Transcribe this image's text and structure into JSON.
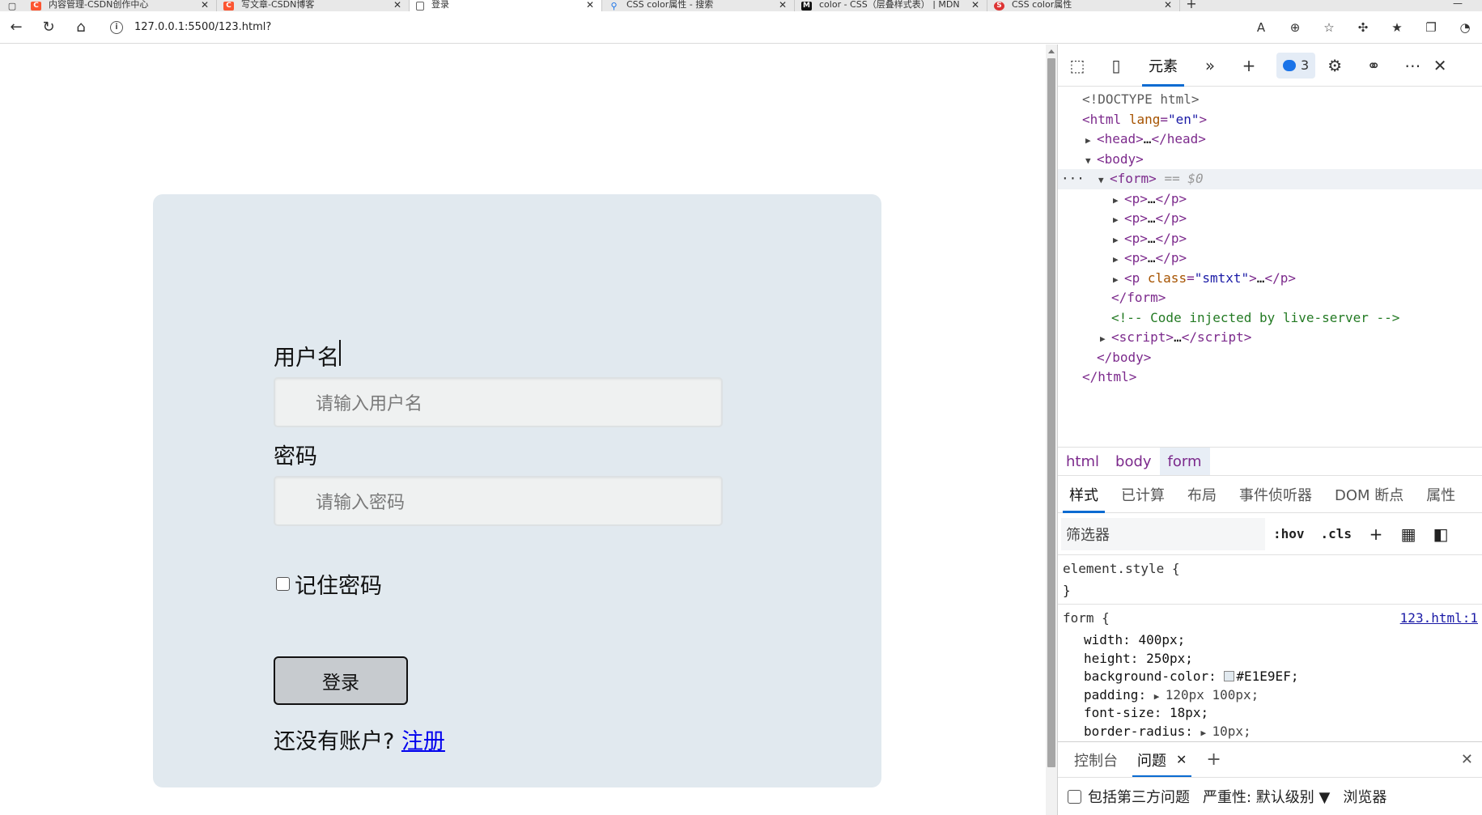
{
  "browser": {
    "tabs": [
      {
        "title": "内容管理-CSDN创作中心",
        "favicon": "C",
        "color": "#fc5531",
        "active": false
      },
      {
        "title": "写文章-CSDN博客",
        "favicon": "C",
        "color": "#fc5531",
        "active": false
      },
      {
        "title": "登录",
        "favicon": "doc",
        "color": "#ffffff",
        "active": true
      },
      {
        "title": "CSS color属性 - 搜索",
        "favicon": "search",
        "color": "#1a73e8",
        "active": false
      },
      {
        "title": "color - CSS（层叠样式表） | MDN",
        "favicon": "M",
        "color": "#111111",
        "active": false
      },
      {
        "title": "CSS color属性",
        "favicon": "S",
        "color": "#d33",
        "active": false
      }
    ],
    "url": "127.0.0.1:5500/123.html?"
  },
  "page": {
    "username_label": "用户名",
    "username_placeholder": "请输入用户名",
    "password_label": "密码",
    "password_placeholder": "请输入密码",
    "remember_label": "记住密码",
    "login_button": "登录",
    "no_account_text": "还没有账户?",
    "register_link": "注册",
    "form_bg": "#E1E9EF"
  },
  "devtools": {
    "main_tab": "元素",
    "issues_count": "3",
    "breadcrumbs": [
      "html",
      "body",
      "form"
    ],
    "sub_tabs": [
      "样式",
      "已计算",
      "布局",
      "事件侦听器",
      "DOM 断点",
      "属性"
    ],
    "filter_placeholder": "筛选器",
    "hov": ":hov",
    "cls": ".cls",
    "element_style_open": "element.style {",
    "element_style_close": "}",
    "form_rule": {
      "selector": "form {",
      "source": "123.html:1",
      "props": [
        {
          "name": "width",
          "value": "400px;"
        },
        {
          "name": "height",
          "value": "250px;"
        },
        {
          "name": "background-color",
          "value": "#E1E9EF;",
          "swatch": "#E1E9EF"
        },
        {
          "name": "padding",
          "value": "120px 100px;",
          "expand": true
        },
        {
          "name": "font-size",
          "value": "18px;"
        },
        {
          "name": "border-radius",
          "value": "10px;",
          "expand": true
        }
      ]
    },
    "drawer_tabs": [
      "控制台",
      "问题"
    ],
    "issues_bar": {
      "third_party": "包括第三方问题",
      "severity": "严重性: 默认级别 ▼",
      "browser": "浏览器"
    }
  }
}
